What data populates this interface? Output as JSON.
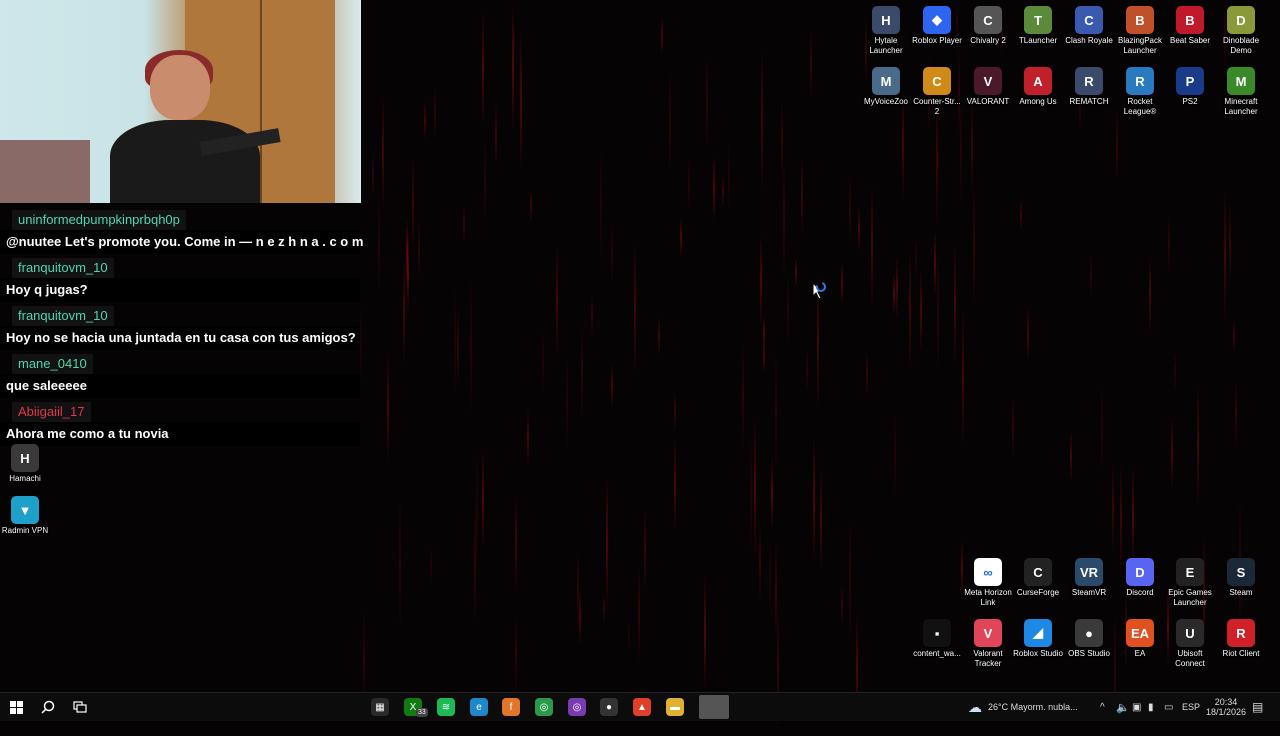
{
  "chat": {
    "messages": [
      {
        "user": "uninformedpumpkinprbqh0p",
        "color": "#4fd6b0",
        "text": "@nuutee Let's promote you. Come in — n e z h n a . c o m"
      },
      {
        "user": "franquitovm_10",
        "color": "#4fd6b0",
        "text": "Hoy q jugas?"
      },
      {
        "user": "franquitovm_10",
        "color": "#4fd6b0",
        "text": "Hoy no se hacia una juntada en tu casa con tus amigos?"
      },
      {
        "user": "mane_0410",
        "color": "#4fd6b0",
        "text": "que saleeeee"
      },
      {
        "user": "Abiigaiil_17",
        "color": "#e0364e",
        "text": "Ahora me como a tu novia"
      }
    ]
  },
  "left_icons": [
    {
      "label": "Hamachi",
      "icon": "hamachi-icon",
      "color": "#3a3a3a",
      "glyph": "H"
    },
    {
      "label": "Radmin VPN",
      "icon": "radmin-vpn-icon",
      "color": "#1fa0c8",
      "glyph": "▼"
    }
  ],
  "top_icons_row1": [
    {
      "label": "Hytale Launcher",
      "icon": "hytale-icon",
      "color": "#3b4a6b",
      "glyph": "H"
    },
    {
      "label": "Roblox Player",
      "icon": "roblox-icon",
      "color": "#2d64f0",
      "glyph": "◆"
    },
    {
      "label": "Chivalry 2",
      "icon": "chivalry-icon",
      "color": "#555555",
      "glyph": "C"
    },
    {
      "label": "TLauncher",
      "icon": "tlauncher-icon",
      "color": "#5a8a3a",
      "glyph": "T"
    },
    {
      "label": "Clash Royale",
      "icon": "clash-royale-icon",
      "color": "#3a5ab0",
      "glyph": "C"
    },
    {
      "label": "BlazingPack Launcher",
      "icon": "blazingpack-icon",
      "color": "#c0502a",
      "glyph": "B"
    },
    {
      "label": "Beat Saber",
      "icon": "beat-saber-icon",
      "color": "#c01a2a",
      "glyph": "B"
    },
    {
      "label": "Dinoblade Demo",
      "icon": "dinoblade-icon",
      "color": "#8a9a3a",
      "glyph": "D"
    }
  ],
  "top_icons_row2": [
    {
      "label": "MyVoiceZoo",
      "icon": "myvoicezoo-icon",
      "color": "#4a6a8a",
      "glyph": "M"
    },
    {
      "label": "Counter-Str... 2",
      "icon": "counter-strike-icon",
      "color": "#d08a1a",
      "glyph": "C"
    },
    {
      "label": "VALORANT",
      "icon": "valorant-icon",
      "color": "#4a1a2a",
      "glyph": "V"
    },
    {
      "label": "Among Us",
      "icon": "among-us-icon",
      "color": "#c0202a",
      "glyph": "A"
    },
    {
      "label": "REMATCH",
      "icon": "rematch-icon",
      "color": "#3a4a6a",
      "glyph": "R"
    },
    {
      "label": "Rocket League®",
      "icon": "rocket-league-icon",
      "color": "#2a7ac0",
      "glyph": "R"
    },
    {
      "label": "PS2",
      "icon": "ps2-icon",
      "color": "#1a3a8a",
      "glyph": "P"
    },
    {
      "label": "Minecraft Launcher",
      "icon": "minecraft-icon",
      "color": "#3a8a2a",
      "glyph": "M"
    }
  ],
  "bottom_icons_row1": [
    {
      "label": "Meta Horizon Link",
      "icon": "meta-horizon-icon",
      "color": "#ffffff",
      "glyph": "∞"
    },
    {
      "label": "CurseForge",
      "icon": "curseforge-icon",
      "color": "#222222",
      "glyph": "C"
    },
    {
      "label": "SteamVR",
      "icon": "steamvr-icon",
      "color": "#2a4a6a",
      "glyph": "VR"
    },
    {
      "label": "Discord",
      "icon": "discord-icon",
      "color": "#5865f2",
      "glyph": "D"
    },
    {
      "label": "Epic Games Launcher",
      "icon": "epic-games-icon",
      "color": "#222222",
      "glyph": "E"
    },
    {
      "label": "Steam",
      "icon": "steam-icon",
      "color": "#1b2838",
      "glyph": "S"
    }
  ],
  "bottom_icons_row2": [
    {
      "label": "content_wa...",
      "icon": "content-file-icon",
      "color": "#111111",
      "glyph": "▪"
    },
    {
      "label": "Valorant Tracker",
      "icon": "valorant-tracker-icon",
      "color": "#e0455a",
      "glyph": "V"
    },
    {
      "label": "Roblox Studio",
      "icon": "roblox-studio-icon",
      "color": "#1e88e5",
      "glyph": "◢"
    },
    {
      "label": "OBS Studio",
      "icon": "obs-icon",
      "color": "#3a3a3a",
      "glyph": "●"
    },
    {
      "label": "EA",
      "icon": "ea-icon",
      "color": "#e05020",
      "glyph": "EA"
    },
    {
      "label": "Ubisoft Connect",
      "icon": "ubisoft-icon",
      "color": "#2a2a2a",
      "glyph": "U"
    },
    {
      "label": "Riot Client",
      "icon": "riot-icon",
      "color": "#d0202a",
      "glyph": "R"
    }
  ],
  "taskbar": {
    "apps": [
      {
        "name": "store-icon",
        "color": "#2a2a2a",
        "glyph": "▦"
      },
      {
        "name": "xbox-icon",
        "color": "#107c10",
        "glyph": "X"
      },
      {
        "name": "spotify-icon",
        "color": "#1db954",
        "glyph": "≋"
      },
      {
        "name": "edge-icon",
        "color": "#1e88c8",
        "glyph": "e"
      },
      {
        "name": "firefox-icon",
        "color": "#e0762a",
        "glyph": "f"
      },
      {
        "name": "chrome-icon",
        "color": "#2a9a4a",
        "glyph": "◎"
      },
      {
        "name": "chrome-profile-icon",
        "color": "#7a3ab0",
        "glyph": "◎"
      },
      {
        "name": "obs-taskbar-icon",
        "color": "#333333",
        "glyph": "●"
      },
      {
        "name": "brave-icon",
        "color": "#e0402a",
        "glyph": "▲"
      },
      {
        "name": "file-explorer-icon",
        "color": "#e0b030",
        "glyph": "▬"
      },
      {
        "name": "active-window-icon",
        "color": "#555555",
        "glyph": ""
      }
    ],
    "xbox_badge": "33",
    "weather": "26°C  Mayorm. nubla...",
    "language": "ESP",
    "time": "20:34",
    "date": "18/1/2026"
  }
}
